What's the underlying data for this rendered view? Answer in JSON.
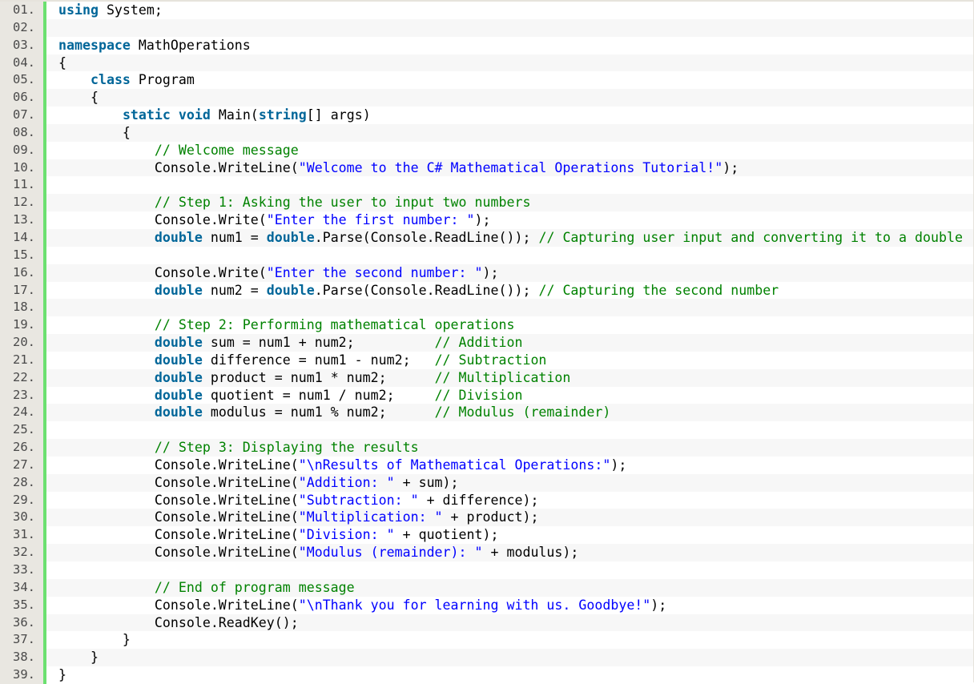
{
  "editor": {
    "language": "C#",
    "colors": {
      "keyword": "#006699",
      "string": "#0000ff",
      "comment": "#008200",
      "plain": "#000000",
      "gutter_bar": "#6ce070"
    },
    "lines": [
      {
        "num": "01.",
        "tokens": [
          {
            "t": "kw",
            "v": "using"
          },
          {
            "t": "pl",
            "v": " System;"
          }
        ]
      },
      {
        "num": "02.",
        "tokens": []
      },
      {
        "num": "03.",
        "tokens": [
          {
            "t": "kw",
            "v": "namespace"
          },
          {
            "t": "pl",
            "v": " MathOperations"
          }
        ]
      },
      {
        "num": "04.",
        "tokens": [
          {
            "t": "pl",
            "v": "{"
          }
        ]
      },
      {
        "num": "05.",
        "tokens": [
          {
            "t": "pl",
            "v": "    "
          },
          {
            "t": "kw",
            "v": "class"
          },
          {
            "t": "pl",
            "v": " Program"
          }
        ]
      },
      {
        "num": "06.",
        "tokens": [
          {
            "t": "pl",
            "v": "    {"
          }
        ]
      },
      {
        "num": "07.",
        "tokens": [
          {
            "t": "pl",
            "v": "        "
          },
          {
            "t": "kw",
            "v": "static"
          },
          {
            "t": "pl",
            "v": " "
          },
          {
            "t": "kw",
            "v": "void"
          },
          {
            "t": "pl",
            "v": " Main("
          },
          {
            "t": "kw",
            "v": "string"
          },
          {
            "t": "pl",
            "v": "[] args)"
          }
        ]
      },
      {
        "num": "08.",
        "tokens": [
          {
            "t": "pl",
            "v": "        {"
          }
        ]
      },
      {
        "num": "09.",
        "tokens": [
          {
            "t": "pl",
            "v": "            "
          },
          {
            "t": "cm",
            "v": "// Welcome message"
          }
        ]
      },
      {
        "num": "10.",
        "tokens": [
          {
            "t": "pl",
            "v": "            Console.WriteLine("
          },
          {
            "t": "str",
            "v": "\"Welcome to the C# Mathematical Operations Tutorial!\""
          },
          {
            "t": "pl",
            "v": ");"
          }
        ]
      },
      {
        "num": "11.",
        "tokens": []
      },
      {
        "num": "12.",
        "tokens": [
          {
            "t": "pl",
            "v": "            "
          },
          {
            "t": "cm",
            "v": "// Step 1: Asking the user to input two numbers"
          }
        ]
      },
      {
        "num": "13.",
        "tokens": [
          {
            "t": "pl",
            "v": "            Console.Write("
          },
          {
            "t": "str",
            "v": "\"Enter the first number: \""
          },
          {
            "t": "pl",
            "v": ");"
          }
        ]
      },
      {
        "num": "14.",
        "tokens": [
          {
            "t": "pl",
            "v": "            "
          },
          {
            "t": "kw",
            "v": "double"
          },
          {
            "t": "pl",
            "v": " num1 = "
          },
          {
            "t": "kw",
            "v": "double"
          },
          {
            "t": "pl",
            "v": ".Parse(Console.ReadLine()); "
          },
          {
            "t": "cm",
            "v": "// Capturing user input and converting it to a double"
          }
        ]
      },
      {
        "num": "15.",
        "tokens": []
      },
      {
        "num": "16.",
        "tokens": [
          {
            "t": "pl",
            "v": "            Console.Write("
          },
          {
            "t": "str",
            "v": "\"Enter the second number: \""
          },
          {
            "t": "pl",
            "v": ");"
          }
        ]
      },
      {
        "num": "17.",
        "tokens": [
          {
            "t": "pl",
            "v": "            "
          },
          {
            "t": "kw",
            "v": "double"
          },
          {
            "t": "pl",
            "v": " num2 = "
          },
          {
            "t": "kw",
            "v": "double"
          },
          {
            "t": "pl",
            "v": ".Parse(Console.ReadLine()); "
          },
          {
            "t": "cm",
            "v": "// Capturing the second number"
          }
        ]
      },
      {
        "num": "18.",
        "tokens": []
      },
      {
        "num": "19.",
        "tokens": [
          {
            "t": "pl",
            "v": "            "
          },
          {
            "t": "cm",
            "v": "// Step 2: Performing mathematical operations"
          }
        ]
      },
      {
        "num": "20.",
        "tokens": [
          {
            "t": "pl",
            "v": "            "
          },
          {
            "t": "kw",
            "v": "double"
          },
          {
            "t": "pl",
            "v": " sum = num1 + num2;          "
          },
          {
            "t": "cm",
            "v": "// Addition"
          }
        ]
      },
      {
        "num": "21.",
        "tokens": [
          {
            "t": "pl",
            "v": "            "
          },
          {
            "t": "kw",
            "v": "double"
          },
          {
            "t": "pl",
            "v": " difference = num1 - num2;   "
          },
          {
            "t": "cm",
            "v": "// Subtraction"
          }
        ]
      },
      {
        "num": "22.",
        "tokens": [
          {
            "t": "pl",
            "v": "            "
          },
          {
            "t": "kw",
            "v": "double"
          },
          {
            "t": "pl",
            "v": " product = num1 * num2;      "
          },
          {
            "t": "cm",
            "v": "// Multiplication"
          }
        ]
      },
      {
        "num": "23.",
        "tokens": [
          {
            "t": "pl",
            "v": "            "
          },
          {
            "t": "kw",
            "v": "double"
          },
          {
            "t": "pl",
            "v": " quotient = num1 / num2;     "
          },
          {
            "t": "cm",
            "v": "// Division"
          }
        ]
      },
      {
        "num": "24.",
        "tokens": [
          {
            "t": "pl",
            "v": "            "
          },
          {
            "t": "kw",
            "v": "double"
          },
          {
            "t": "pl",
            "v": " modulus = num1 % num2;      "
          },
          {
            "t": "cm",
            "v": "// Modulus (remainder)"
          }
        ]
      },
      {
        "num": "25.",
        "tokens": []
      },
      {
        "num": "26.",
        "tokens": [
          {
            "t": "pl",
            "v": "            "
          },
          {
            "t": "cm",
            "v": "// Step 3: Displaying the results"
          }
        ]
      },
      {
        "num": "27.",
        "tokens": [
          {
            "t": "pl",
            "v": "            Console.WriteLine("
          },
          {
            "t": "str",
            "v": "\"\\nResults of Mathematical Operations:\""
          },
          {
            "t": "pl",
            "v": ");"
          }
        ]
      },
      {
        "num": "28.",
        "tokens": [
          {
            "t": "pl",
            "v": "            Console.WriteLine("
          },
          {
            "t": "str",
            "v": "\"Addition: \""
          },
          {
            "t": "pl",
            "v": " + sum);"
          }
        ]
      },
      {
        "num": "29.",
        "tokens": [
          {
            "t": "pl",
            "v": "            Console.WriteLine("
          },
          {
            "t": "str",
            "v": "\"Subtraction: \""
          },
          {
            "t": "pl",
            "v": " + difference);"
          }
        ]
      },
      {
        "num": "30.",
        "tokens": [
          {
            "t": "pl",
            "v": "            Console.WriteLine("
          },
          {
            "t": "str",
            "v": "\"Multiplication: \""
          },
          {
            "t": "pl",
            "v": " + product);"
          }
        ]
      },
      {
        "num": "31.",
        "tokens": [
          {
            "t": "pl",
            "v": "            Console.WriteLine("
          },
          {
            "t": "str",
            "v": "\"Division: \""
          },
          {
            "t": "pl",
            "v": " + quotient);"
          }
        ]
      },
      {
        "num": "32.",
        "tokens": [
          {
            "t": "pl",
            "v": "            Console.WriteLine("
          },
          {
            "t": "str",
            "v": "\"Modulus (remainder): \""
          },
          {
            "t": "pl",
            "v": " + modulus);"
          }
        ]
      },
      {
        "num": "33.",
        "tokens": []
      },
      {
        "num": "34.",
        "tokens": [
          {
            "t": "pl",
            "v": "            "
          },
          {
            "t": "cm",
            "v": "// End of program message"
          }
        ]
      },
      {
        "num": "35.",
        "tokens": [
          {
            "t": "pl",
            "v": "            Console.WriteLine("
          },
          {
            "t": "str",
            "v": "\"\\nThank you for learning with us. Goodbye!\""
          },
          {
            "t": "pl",
            "v": ");"
          }
        ]
      },
      {
        "num": "36.",
        "tokens": [
          {
            "t": "pl",
            "v": "            Console.ReadKey();"
          }
        ]
      },
      {
        "num": "37.",
        "tokens": [
          {
            "t": "pl",
            "v": "        }"
          }
        ]
      },
      {
        "num": "38.",
        "tokens": [
          {
            "t": "pl",
            "v": "    }"
          }
        ]
      },
      {
        "num": "39.",
        "tokens": [
          {
            "t": "pl",
            "v": "}"
          }
        ]
      }
    ]
  }
}
